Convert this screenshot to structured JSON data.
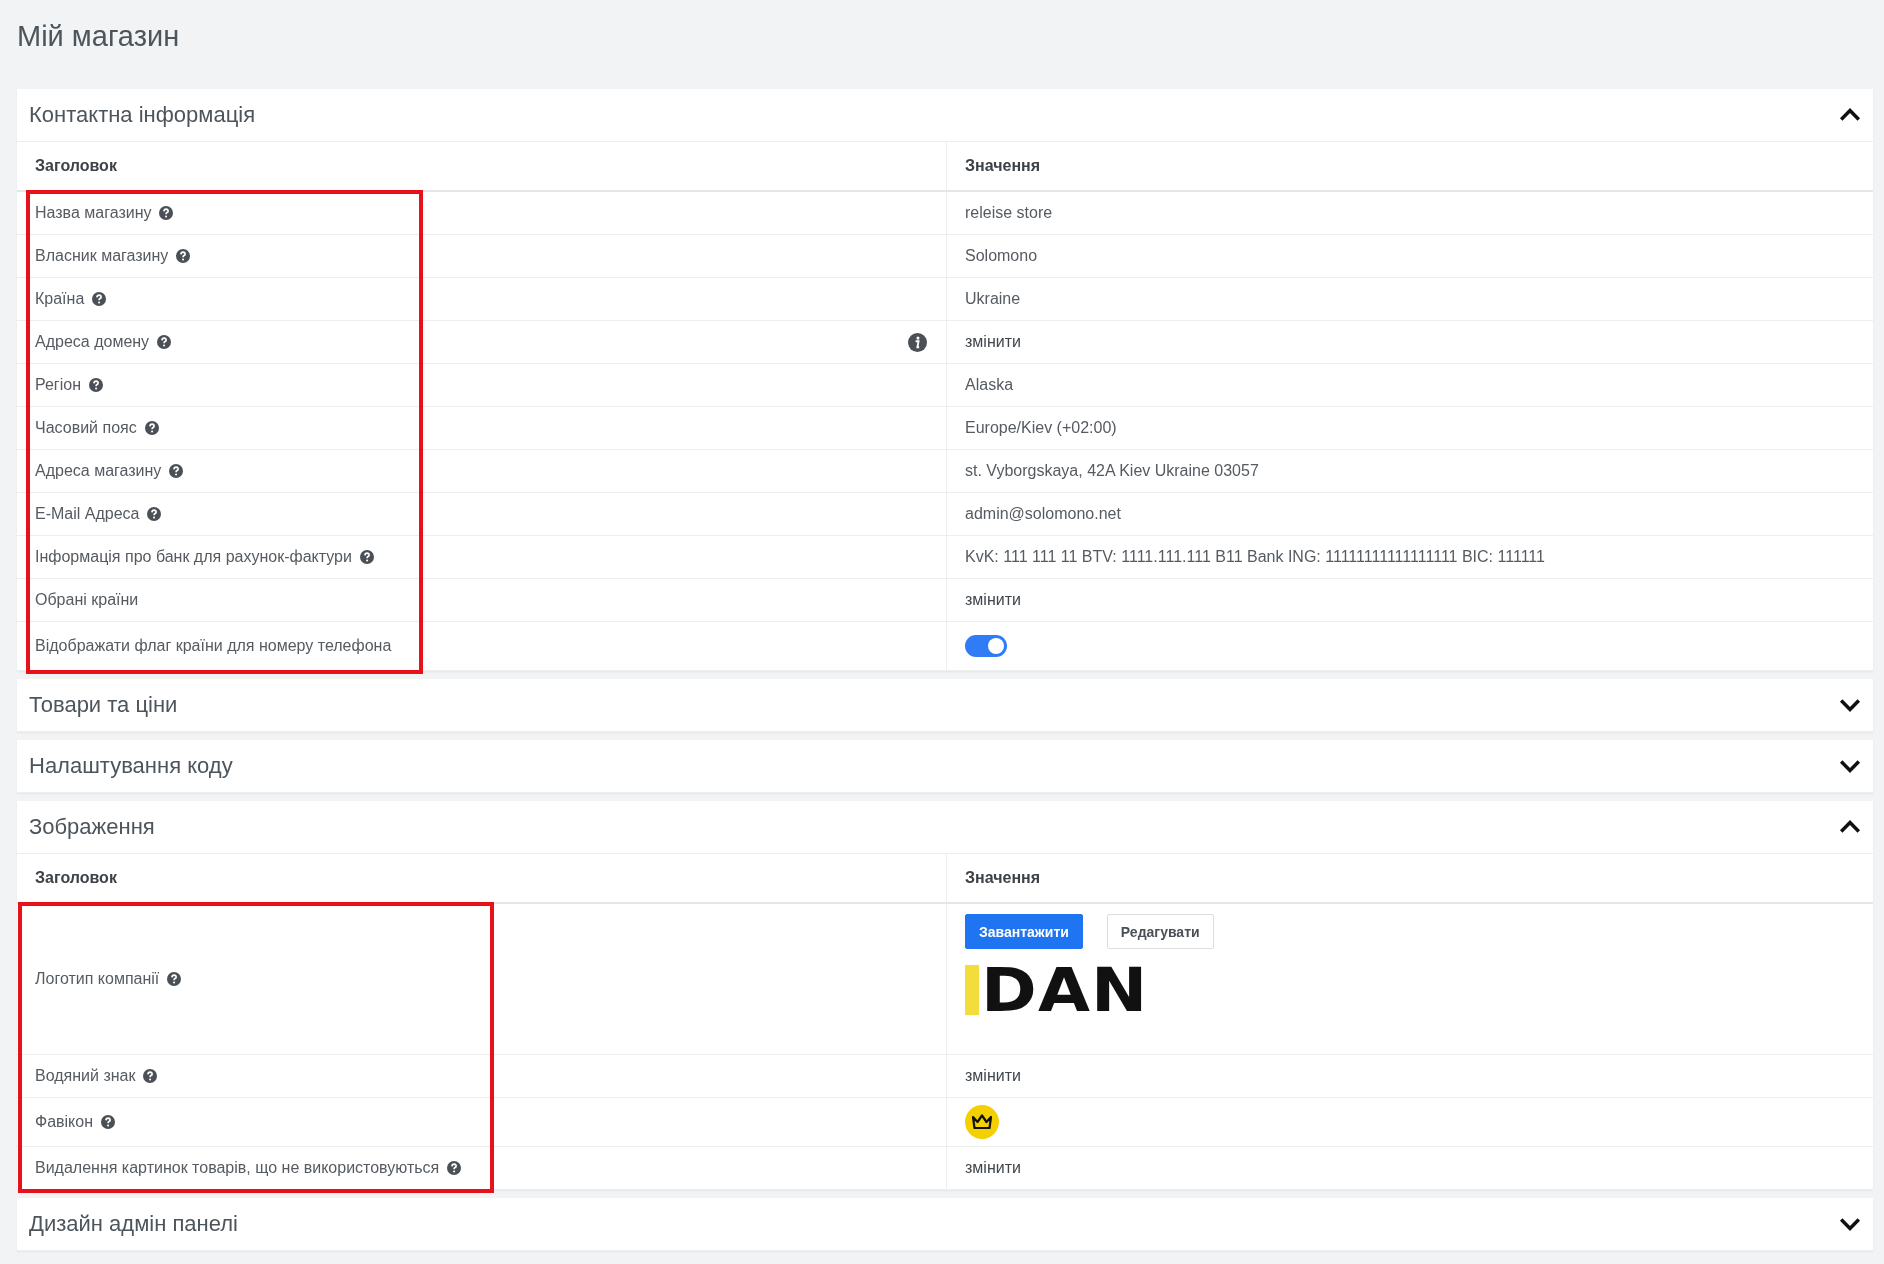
{
  "page_title": "Мій магазин",
  "sections": [
    {
      "title": "Контактна інформація",
      "expanded": true,
      "highlighted": true,
      "columns": [
        "Заголовок",
        "Значення"
      ],
      "rows": [
        {
          "label": "Назва магазину",
          "help": true,
          "kind": "text",
          "value": "releise store"
        },
        {
          "label": "Власник магазину",
          "help": true,
          "kind": "text",
          "value": "Solomono"
        },
        {
          "label": "Країна",
          "help": true,
          "kind": "text",
          "value": "Ukraine"
        },
        {
          "label": "Адреса домену",
          "help": true,
          "info": true,
          "kind": "link",
          "value": "змінити"
        },
        {
          "label": "Регіон",
          "help": true,
          "kind": "text",
          "value": "Alaska"
        },
        {
          "label": "Часовий пояс",
          "help": true,
          "kind": "text",
          "value": "Europe/Kiev (+02:00)"
        },
        {
          "label": "Адреса магазину",
          "help": true,
          "kind": "text",
          "value": "st. Vyborgskaya, 42A Kiev Ukraine 03057"
        },
        {
          "label": "E-Mail Адреса",
          "help": true,
          "kind": "text",
          "value": "admin@solomono.net"
        },
        {
          "label": "Інформація про банк для рахунок-фактури",
          "help": true,
          "kind": "text",
          "value": "KvK: 111 111 11 BTV: 1111.111.111 B11 Bank ING: 11111111111111111 BIC: 111111"
        },
        {
          "label": "Обрані країни",
          "help": false,
          "kind": "link",
          "value": "змінити"
        },
        {
          "label": "Відображати флаг країни для номеру телефона",
          "help": false,
          "kind": "toggle",
          "on": true
        }
      ]
    },
    {
      "title": "Товари та ціни",
      "expanded": false
    },
    {
      "title": "Налаштування коду",
      "expanded": false
    },
    {
      "title": "Зображення",
      "expanded": true,
      "highlighted": true,
      "columns": [
        "Заголовок",
        "Значення"
      ],
      "rows": [
        {
          "label": "Логотип компанії",
          "help": true,
          "kind": "logo",
          "buttons": [
            {
              "label": "Завантажити",
              "primary": true
            },
            {
              "label": "Редагувати",
              "primary": false
            }
          ],
          "logo_text": "DAN"
        },
        {
          "label": "Водяний знак",
          "help": true,
          "kind": "link",
          "value": "змінити"
        },
        {
          "label": "Фавікон",
          "help": true,
          "kind": "favicon"
        },
        {
          "label": "Видалення картинок товарів, що не використовуються",
          "help": true,
          "kind": "link",
          "value": "змінити"
        }
      ]
    },
    {
      "title": "Дизайн адмін панелі",
      "expanded": false
    }
  ]
}
